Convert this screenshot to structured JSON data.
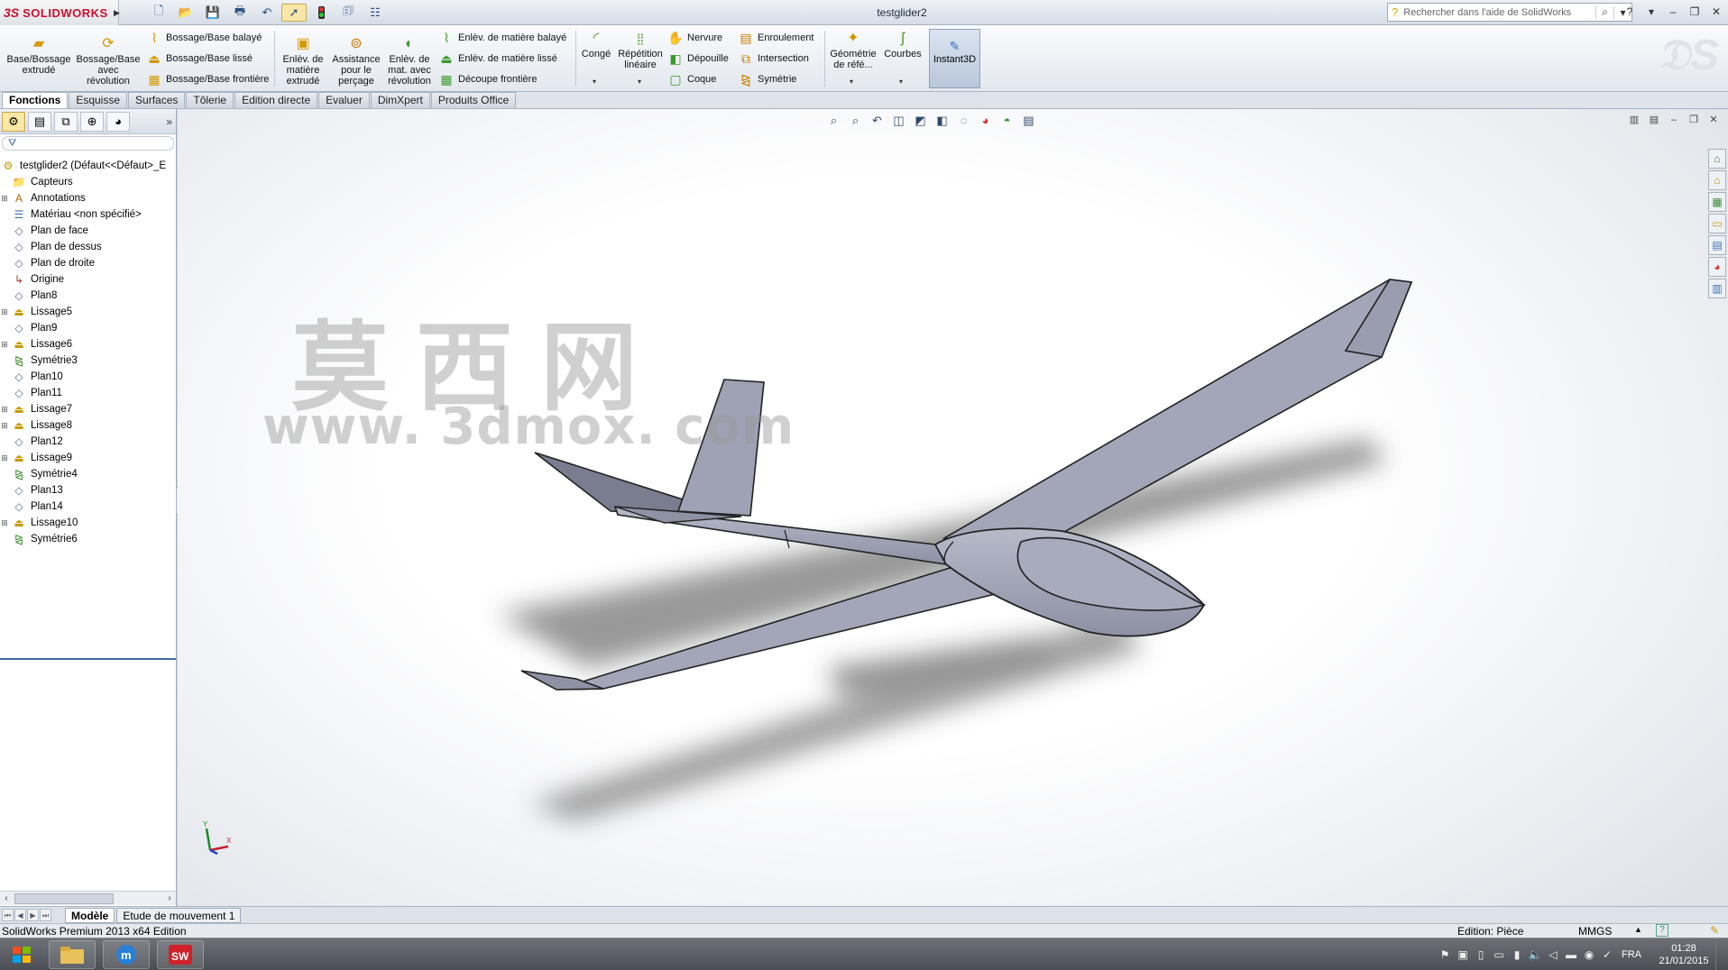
{
  "titlebar": {
    "brand_ds": "3S",
    "brand": "SOLIDWORKS",
    "document_title": "testglider2",
    "help_search_placeholder": "Rechercher dans l'aide de SolidWorks",
    "quick_icons": [
      "new-document-icon",
      "open-folder-icon",
      "save-icon",
      "print-icon",
      "undo-icon",
      "select-cursor-icon",
      "rebuild-traffic-light-icon",
      "file-properties-icon",
      "options-icon"
    ]
  },
  "ribbon": {
    "base_extrude": "Base/Bossage extrudé",
    "base_revolve": "Bossage/Base avec révolution",
    "boss_sweep": "Bossage/Base balayé",
    "boss_loft": "Bossage/Base lissé",
    "boss_boundary": "Bossage/Base frontière",
    "cut_extrude": "Enlèv. de matière extrudé",
    "hole_wizard": "Assistance pour le perçage",
    "cut_revolve": "Enlèv. de mat. avec révolution",
    "cut_sweep": "Enlèv. de matière balayé",
    "cut_loft": "Enlèv. de matière lissé",
    "cut_boundary": "Découpe frontière",
    "fillet": "Congé",
    "linear_pattern": "Répétition linéaire",
    "rib": "Nervure",
    "draft": "Dépouille",
    "shell": "Coque",
    "wrap": "Enroulement",
    "intersect": "Intersection",
    "mirror": "Symétrie",
    "ref_geometry": "Géométrie de réfé...",
    "curves": "Courbes",
    "instant3d": "Instant3D"
  },
  "command_tabs": [
    "Fonctions",
    "Esquisse",
    "Surfaces",
    "Tôlerie",
    "Edition directe",
    "Evaluer",
    "DimXpert",
    "Produits Office"
  ],
  "feature_tree": {
    "root": "testglider2  (Défaut<<Défaut>_E",
    "items": [
      {
        "label": "Capteurs",
        "icon": "sensor-folder-icon",
        "expandable": false
      },
      {
        "label": "Annotations",
        "icon": "annotations-icon",
        "expandable": true
      },
      {
        "label": "Matériau <non spécifié>",
        "icon": "material-icon",
        "expandable": false
      },
      {
        "label": "Plan de face",
        "icon": "plane-icon",
        "expandable": false
      },
      {
        "label": "Plan de dessus",
        "icon": "plane-icon",
        "expandable": false
      },
      {
        "label": "Plan de droite",
        "icon": "plane-icon",
        "expandable": false
      },
      {
        "label": "Origine",
        "icon": "origin-icon",
        "expandable": false
      },
      {
        "label": "Plan8",
        "icon": "plane-icon",
        "expandable": false
      },
      {
        "label": "Lissage5",
        "icon": "loft-icon",
        "expandable": true
      },
      {
        "label": "Plan9",
        "icon": "plane-icon",
        "expandable": false
      },
      {
        "label": "Lissage6",
        "icon": "loft-icon",
        "expandable": true
      },
      {
        "label": "Symétrie3",
        "icon": "mirror-icon",
        "expandable": false
      },
      {
        "label": "Plan10",
        "icon": "plane-icon",
        "expandable": false
      },
      {
        "label": "Plan11",
        "icon": "plane-icon",
        "expandable": false
      },
      {
        "label": "Lissage7",
        "icon": "loft-icon",
        "expandable": true
      },
      {
        "label": "Lissage8",
        "icon": "loft-icon",
        "expandable": true
      },
      {
        "label": "Plan12",
        "icon": "plane-icon",
        "expandable": false
      },
      {
        "label": "Lissage9",
        "icon": "loft-icon",
        "expandable": true
      },
      {
        "label": "Symétrie4",
        "icon": "mirror-icon",
        "expandable": false
      },
      {
        "label": "Plan13",
        "icon": "plane-icon",
        "expandable": false
      },
      {
        "label": "Plan14",
        "icon": "plane-icon",
        "expandable": false
      },
      {
        "label": "Lissage10",
        "icon": "loft-icon",
        "expandable": true
      },
      {
        "label": "Symétrie6",
        "icon": "mirror-icon",
        "expandable": false
      }
    ]
  },
  "viewport": {
    "watermark_cn": "莫西网",
    "watermark_url": "www. 3dmox. com",
    "triad_y": "Y",
    "triad_x": "X",
    "model_color": "#a3a6b8",
    "shadow_color": "#3a3a3a"
  },
  "bottom_tabs": [
    "Modèle",
    "Etude de mouvement 1"
  ],
  "status": {
    "left": "SolidWorks Premium 2013 x64 Edition",
    "edit": "Edition: Pièce",
    "units": "MMGS",
    "help": "?"
  },
  "taskbar": {
    "lang": "FRA",
    "time": "01:28",
    "date": "21/01/2015"
  }
}
